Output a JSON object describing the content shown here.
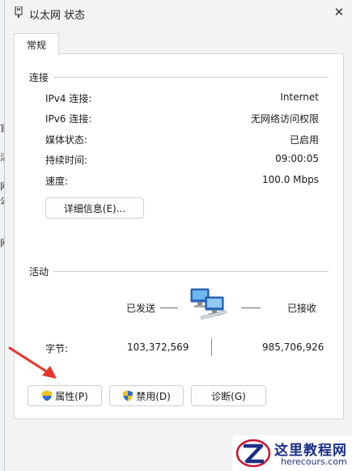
{
  "window": {
    "title": "以太网 状态"
  },
  "tabs": [
    {
      "label": "常规"
    }
  ],
  "connection": {
    "group_title": "连接",
    "rows": [
      {
        "label": "IPv4 连接:",
        "value": "Internet"
      },
      {
        "label": "IPv6 连接:",
        "value": "无网络访问权限"
      },
      {
        "label": "媒体状态:",
        "value": "已启用"
      },
      {
        "label": "持续时间:",
        "value": "09:00:05"
      },
      {
        "label": "速度:",
        "value": "100.0 Mbps"
      }
    ],
    "details_button": "详细信息(E)..."
  },
  "activity": {
    "group_title": "活动",
    "sent_label": "已发送",
    "received_label": "已接收",
    "bytes_label": "字节:",
    "bytes_sent": "103,372,569",
    "bytes_received": "985,706,926"
  },
  "buttons": {
    "properties": "属性(P)",
    "disable": "禁用(D)",
    "diagnose": "诊断(G)"
  },
  "background_glyphs": [
    "官",
    "活",
    "网",
    "公",
    "网"
  ],
  "watermark": {
    "chinese": "这里教程网",
    "url": "herecours.com",
    "color": "#1c2f86"
  },
  "colors": {
    "annotation_arrow": "#e8352a",
    "shield_blue": "#2d6fd1",
    "shield_yellow": "#f2c21a"
  },
  "icons": {
    "title": "network-adapter-icon",
    "close": "close-icon",
    "network": "network-computers-icon",
    "shield": "uac-shield-icon"
  }
}
